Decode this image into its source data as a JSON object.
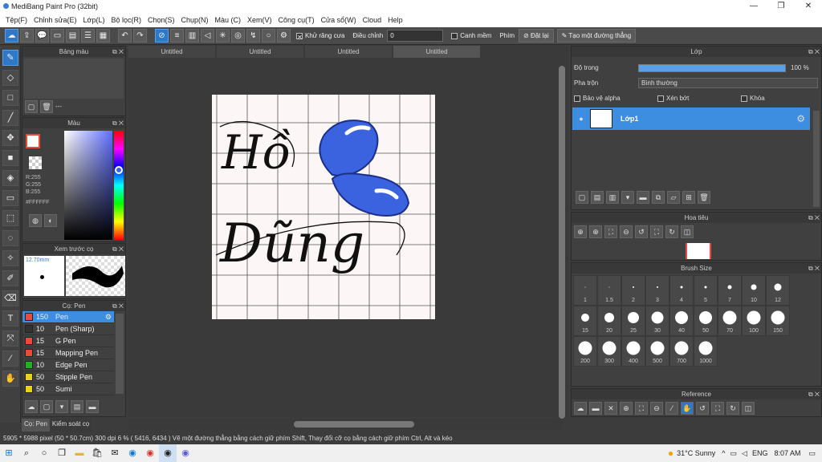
{
  "window": {
    "title": "MediBang Paint Pro (32bit)",
    "minimize": "—",
    "maximize": "❐",
    "close": "✕"
  },
  "menu": [
    "Tệp(F)",
    "Chỉnh sửa(E)",
    "Lớp(L)",
    "Bộ lọc(R)",
    "Chọn(S)",
    "Chụp(N)",
    "Màu (C)",
    "Xem(V)",
    "Công cụ(T)",
    "Cửa sổ(W)",
    "Cloud",
    "Help"
  ],
  "toolbar": {
    "antialias_label": "Khử răng cưa",
    "adjust_label": "Điều chỉnh",
    "adjust_value": "0",
    "canh_label": "Canh mềm",
    "phim_label": "Phím",
    "reset_label": "Đặt lại",
    "straight_label": "Tạo một đường thẳng"
  },
  "panels": {
    "bang_mau": "Bảng màu",
    "bang_mau_dashes": "---",
    "mau": "Màu",
    "rgb": {
      "r": "R:255",
      "g": "G:255",
      "b": "B:255",
      "hex": "#FFFFFF"
    },
    "preview": "Xem trước cọ",
    "preview_size": "12.70mm",
    "brush_panel": "Cọ: Pen",
    "brush_tab_a": "Cọ: Pen",
    "brush_tab_b": "Kiểm soát cọ",
    "brushes": [
      {
        "size": "150",
        "name": "Pen",
        "color": "#e84b3c",
        "active": true
      },
      {
        "size": "10",
        "name": "Pen (Sharp)",
        "color": "#333333",
        "active": false
      },
      {
        "size": "15",
        "name": "G Pen",
        "color": "#e84b3c",
        "active": false
      },
      {
        "size": "15",
        "name": "Mapping Pen",
        "color": "#e84b3c",
        "active": false
      },
      {
        "size": "10",
        "name": "Edge Pen",
        "color": "#1fb31f",
        "active": false
      },
      {
        "size": "50",
        "name": "Stipple Pen",
        "color": "#e8d21c",
        "active": false
      },
      {
        "size": "50",
        "name": "Sumi",
        "color": "#e8d21c",
        "active": false
      }
    ]
  },
  "tabs": [
    "Untitled",
    "Untitled",
    "Untitled",
    "Untitled"
  ],
  "layer_panel": {
    "title": "Lớp",
    "opacity_label": "Độ trong",
    "opacity_value": "100 %",
    "opacity": 1.0,
    "blend_label": "Pha trộn",
    "blend_value": "Bình thường",
    "protect_alpha": "Bảo vệ alpha",
    "clip": "Xén bớt",
    "lock": "Khóa",
    "layer_name": "Lớp1"
  },
  "navigator_title": "Hoa tiêu",
  "brush_size": {
    "title": "Brush Size",
    "sizes": [
      "1",
      "1.5",
      "2",
      "3",
      "4",
      "5",
      "7",
      "10",
      "12",
      "15",
      "20",
      "25",
      "30",
      "40",
      "50",
      "70",
      "100",
      "150",
      "200",
      "300",
      "400",
      "500",
      "700",
      "1000"
    ]
  },
  "reference_title": "Reference",
  "canvas_text": {
    "line1": "Hồ",
    "line2": "Dũng"
  },
  "status": "5905 * 5988 pixel  (50 * 50.7cm)  300 dpi  6 %  ( 5416, 6434 )  Vẽ một đường thẳng bằng cách giữ phím Shift, Thay đổi cỡ cọ bằng cách giữ phím Ctrl, Alt và kéo",
  "taskbar": {
    "weather": "31°C  Sunny",
    "lang": "ENG",
    "time": "8:07 AM"
  },
  "colors": {
    "accent": "#2e78c7",
    "primary_color": "#e84b3c",
    "blob": "#3b63e0"
  }
}
